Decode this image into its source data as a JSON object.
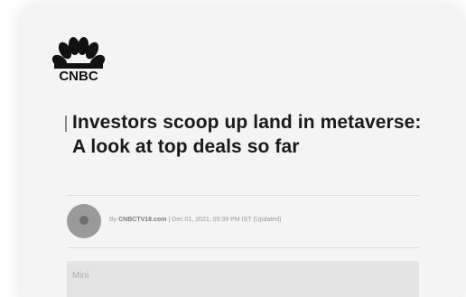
{
  "brand": {
    "name": "CNBC"
  },
  "article": {
    "headline": "Investors scoop up land in metaverse: A look at top deals so far",
    "byline_prefix": "By",
    "source": "CNBCTV18.com",
    "separator": "|",
    "date": "Dec 01, 2021, 05:39 PM IST (Updated)"
  },
  "below": {
    "label": "Mini"
  }
}
